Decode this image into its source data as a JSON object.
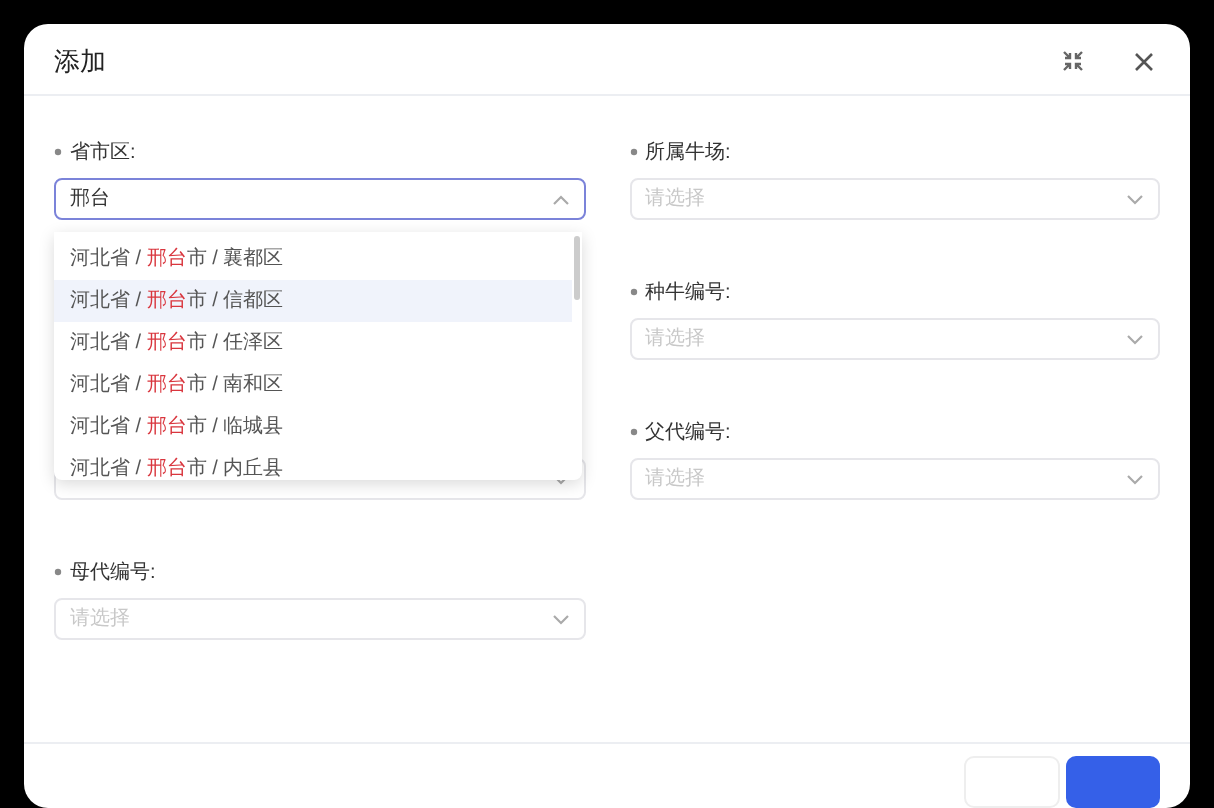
{
  "dialog": {
    "title": "添加"
  },
  "fields": [
    {
      "label": "省市区:",
      "required": true,
      "value": "邢台",
      "focused": true,
      "open": true
    },
    {
      "label": "所属牛场:",
      "required": true,
      "placeholder": "请选择",
      "focused": false,
      "open": false
    },
    {
      "label": "种牛编号:",
      "required": true,
      "placeholder": "请选择",
      "focused": false,
      "open": false
    },
    {
      "label": "父代编号:",
      "required": true,
      "placeholder": "请选择",
      "focused": false,
      "open": false
    },
    {
      "label": "母代编号:",
      "required": true,
      "placeholder": "请选择",
      "focused": false,
      "open": false
    }
  ],
  "dropdown": {
    "options": [
      {
        "selected": false,
        "segments": [
          {
            "text": "河北省 / "
          },
          {
            "text": "邢台",
            "highlight": true
          },
          {
            "text": "市 / 襄都区"
          }
        ]
      },
      {
        "selected": true,
        "segments": [
          {
            "text": "河北省 / "
          },
          {
            "text": "邢台",
            "highlight": true
          },
          {
            "text": "市 / 信都区"
          }
        ]
      },
      {
        "selected": false,
        "segments": [
          {
            "text": "河北省 / "
          },
          {
            "text": "邢台",
            "highlight": true
          },
          {
            "text": "市 / 任泽区"
          }
        ]
      },
      {
        "selected": false,
        "segments": [
          {
            "text": "河北省 / "
          },
          {
            "text": "邢台",
            "highlight": true
          },
          {
            "text": "市 / 南和区"
          }
        ]
      },
      {
        "selected": false,
        "segments": [
          {
            "text": "河北省 / "
          },
          {
            "text": "邢台",
            "highlight": true
          },
          {
            "text": "市 / 临城县"
          }
        ]
      },
      {
        "selected": false,
        "segments": [
          {
            "text": "河北省 / "
          },
          {
            "text": "邢台",
            "highlight": true
          },
          {
            "text": "市 / 内丘县"
          }
        ]
      }
    ]
  }
}
